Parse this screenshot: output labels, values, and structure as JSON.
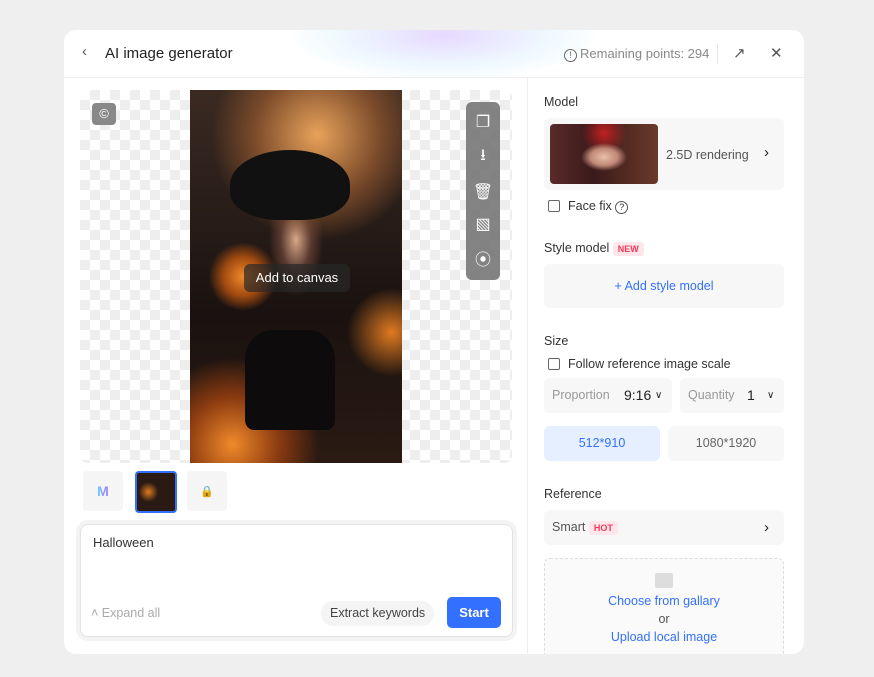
{
  "header": {
    "title": "AI image generator",
    "remaining_points": "Remaining points: 294"
  },
  "canvas": {
    "add_to_canvas": "Add to canvas",
    "tools": [
      "copy-icon",
      "download-icon",
      "delete-icon",
      "image-edit-icon",
      "link-icon"
    ]
  },
  "prompt": {
    "value": "Halloween",
    "expand_all": "Expand all",
    "extract_keywords": "Extract keywords",
    "start": "Start"
  },
  "settings": {
    "model_label": "Model",
    "model_name": "2.5D rendering",
    "face_fix": "Face fix",
    "style_model_label": "Style model",
    "style_badge": "NEW",
    "add_style_model": "+ Add style model",
    "size_label": "Size",
    "follow_reference": "Follow reference image scale",
    "proportion_label": "Proportion",
    "proportion_value": "9:16",
    "quantity_label": "Quantity",
    "quantity_value": "1",
    "sizes": [
      "512*910",
      "1080*1920"
    ],
    "selected_size": "512*910",
    "reference_label": "Reference",
    "reference_mode": "Smart",
    "reference_badge": "HOT",
    "choose_gallery": "Choose from gallary",
    "or": "or",
    "upload_local": "Upload local image"
  },
  "colors": {
    "accent": "#3370ff",
    "badge": "#f03a5a"
  }
}
